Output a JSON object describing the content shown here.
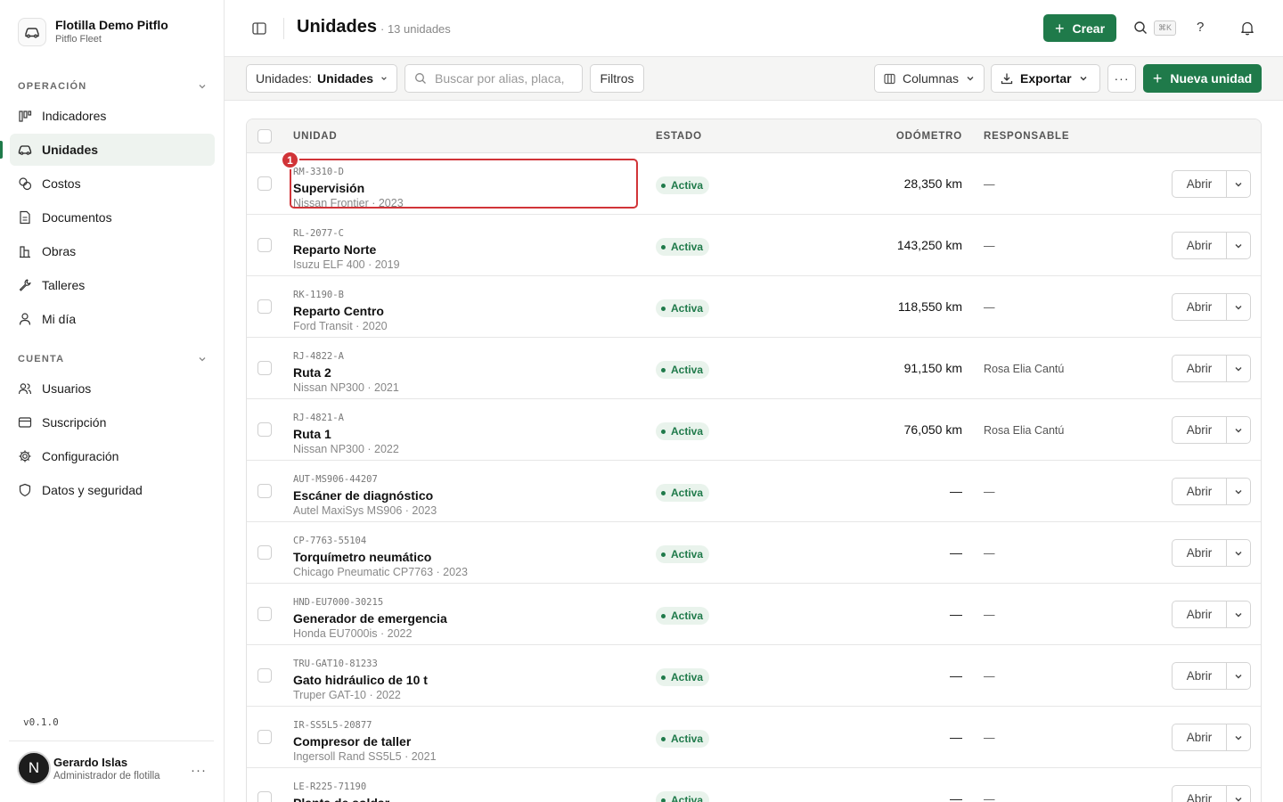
{
  "brand": {
    "name": "Flotilla Demo Pitflo",
    "subtitle": "Pitflo Fleet"
  },
  "sidebar": {
    "sections": [
      {
        "title": "OPERACIÓN",
        "items": [
          {
            "label": "Indicadores",
            "icon": "bar-chart-icon"
          },
          {
            "label": "Unidades",
            "icon": "car-icon",
            "active": true
          },
          {
            "label": "Costos",
            "icon": "coins-icon"
          },
          {
            "label": "Documentos",
            "icon": "file-icon"
          },
          {
            "label": "Obras",
            "icon": "building-icon"
          },
          {
            "label": "Talleres",
            "icon": "wrench-icon"
          },
          {
            "label": "Mi día",
            "icon": "user-icon"
          }
        ]
      },
      {
        "title": "CUENTA",
        "items": [
          {
            "label": "Usuarios",
            "icon": "users-icon"
          },
          {
            "label": "Suscripción",
            "icon": "credit-card-icon"
          },
          {
            "label": "Configuración",
            "icon": "gear-icon"
          },
          {
            "label": "Datos y seguridad",
            "icon": "shield-icon"
          }
        ]
      }
    ],
    "version": "v0.1.0",
    "user": {
      "initial": "N",
      "name": "Gerardo Islas",
      "role": "Administrador de flotilla"
    }
  },
  "header": {
    "title": "Unidades",
    "count": "· 13 unidades",
    "create_label": "Crear",
    "shortcut": "⌘K",
    "help": "?"
  },
  "toolbar": {
    "view_prefix": "Unidades:",
    "view_value": "Unidades",
    "search_placeholder": "Buscar por alias, placa,",
    "filters_label": "Filtros",
    "columns_label": "Columnas",
    "export_label": "Exportar",
    "more_label": "···",
    "new_label": "Nueva unidad"
  },
  "table": {
    "headers": {
      "unit": "UNIDAD",
      "status": "ESTADO",
      "odometer": "ODÓMETRO",
      "owner": "RESPONSABLE"
    },
    "open_label": "Abrir",
    "rows": [
      {
        "code": "RM-3310-D",
        "alias": "Supervisión",
        "model": "Nissan Frontier · 2023",
        "status": "Activa",
        "odometer": "28,350 km",
        "owner": "—"
      },
      {
        "code": "RL-2077-C",
        "alias": "Reparto Norte",
        "model": "Isuzu ELF 400 · 2019",
        "status": "Activa",
        "odometer": "143,250 km",
        "owner": "—"
      },
      {
        "code": "RK-1190-B",
        "alias": "Reparto Centro",
        "model": "Ford Transit · 2020",
        "status": "Activa",
        "odometer": "118,550 km",
        "owner": "—"
      },
      {
        "code": "RJ-4822-A",
        "alias": "Ruta 2",
        "model": "Nissan NP300 · 2021",
        "status": "Activa",
        "odometer": "91,150 km",
        "owner": "Rosa Elia Cantú"
      },
      {
        "code": "RJ-4821-A",
        "alias": "Ruta 1",
        "model": "Nissan NP300 · 2022",
        "status": "Activa",
        "odometer": "76,050 km",
        "owner": "Rosa Elia Cantú"
      },
      {
        "code": "AUT-MS906-44207",
        "alias": "Escáner de diagnóstico",
        "model": "Autel MaxiSys MS906 · 2023",
        "status": "Activa",
        "odometer": "—",
        "owner": "—"
      },
      {
        "code": "CP-7763-55104",
        "alias": "Torquímetro neumático",
        "model": "Chicago Pneumatic CP7763 · 2023",
        "status": "Activa",
        "odometer": "—",
        "owner": "—"
      },
      {
        "code": "HND-EU7000-30215",
        "alias": "Generador de emergencia",
        "model": "Honda EU7000is · 2022",
        "status": "Activa",
        "odometer": "—",
        "owner": "—"
      },
      {
        "code": "TRU-GAT10-81233",
        "alias": "Gato hidráulico de 10 t",
        "model": "Truper GAT-10 · 2022",
        "status": "Activa",
        "odometer": "—",
        "owner": "—"
      },
      {
        "code": "IR-SS5L5-20877",
        "alias": "Compresor de taller",
        "model": "Ingersoll Rand SS5L5 · 2021",
        "status": "Activa",
        "odometer": "—",
        "owner": "—"
      },
      {
        "code": "LE-R225-71190",
        "alias": "Planta de soldar",
        "model": "",
        "status": "Activa",
        "odometer": "—",
        "owner": "—"
      }
    ]
  },
  "annotation": {
    "marker": "1"
  },
  "colors": {
    "accent": "#1f7a4a",
    "highlight": "#d13438",
    "badge_bg": "#e9f3ec"
  }
}
